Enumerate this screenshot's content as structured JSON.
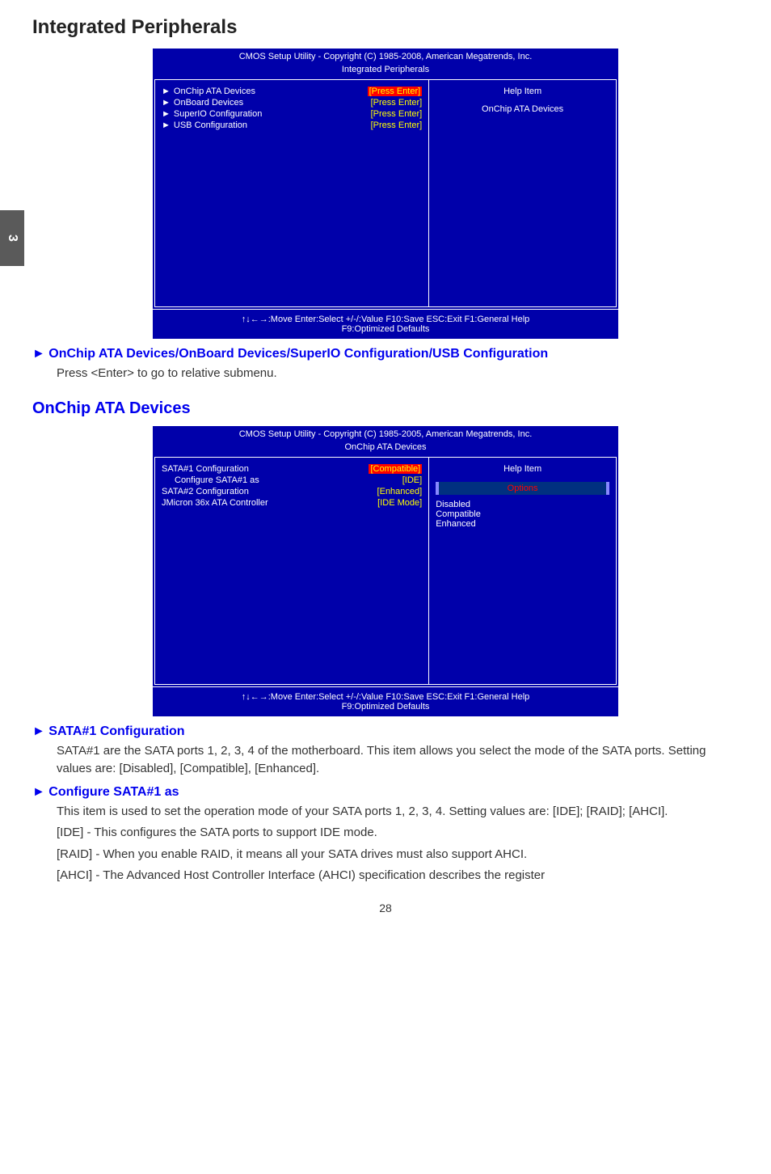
{
  "tab": "3",
  "h1": "Integrated Peripherals",
  "bios1": {
    "title": "CMOS Setup Utility - Copyright (C) 1985-2008, American Megatrends, Inc.",
    "subtitle": "Integrated Peripherals",
    "rows": [
      {
        "label": "OnChip ATA Devices",
        "val": "[Press Enter]",
        "hl": true,
        "arrow": true
      },
      {
        "label": "OnBoard Devices",
        "val": "[Press Enter]",
        "hl": false,
        "arrow": true
      },
      {
        "label": "SuperIO Configuration",
        "val": "[Press Enter]",
        "hl": false,
        "arrow": true
      },
      {
        "label": "USB Configuration",
        "val": "[Press Enter]",
        "hl": false,
        "arrow": true
      }
    ],
    "helpTitle": "Help Item",
    "helpText": "OnChip ATA Devices",
    "foot1": "↑↓←→:Move   Enter:Select   +/-/:Value   F10:Save   ESC:Exit    F1:General Help",
    "foot2": "F9:Optimized Defaults"
  },
  "sec1": {
    "head": "► OnChip ATA Devices/OnBoard Devices/SuperIO Configuration/USB Configuration",
    "body": "Press <Enter> to go to relative submenu."
  },
  "h2": "OnChip ATA Devices",
  "bios2": {
    "title": "CMOS Setup Utility - Copyright (C) 1985-2005, American Megatrends, Inc.",
    "subtitle": "OnChip ATA Devices",
    "rows": [
      {
        "label": "SATA#1 Configuration",
        "val": "[Compatible]",
        "hl": true,
        "indent": false
      },
      {
        "label": "Configure SATA#1 as",
        "val": "[IDE]",
        "hl": false,
        "indent": true
      },
      {
        "label": "SATA#2 Configuration",
        "val": "[Enhanced]",
        "hl": false,
        "indent": false
      },
      {
        "label": "JMicron 36x ATA Controller",
        "val": "[IDE Mode]",
        "hl": false,
        "indent": false
      }
    ],
    "helpTitle": "Help Item",
    "optionsHdr": "Options",
    "opts": [
      "Disabled",
      "Compatible",
      "Enhanced"
    ],
    "foot1": "↑↓←→:Move   Enter:Select   +/-/:Value   F10:Save   ESC:Exit    F1:General Help",
    "foot2": "F9:Optimized Defaults"
  },
  "sec2": {
    "head": "► SATA#1 Configuration",
    "body": "SATA#1 are the SATA ports 1, 2, 3, 4 of the motherboard. This item allows you select the mode of the SATA ports. Setting values are: [Disabled], [Compatible], [Enhanced]."
  },
  "sec3": {
    "head": "► Configure SATA#1 as",
    "b1": "This  item is used to set the operation mode of your SATA ports 1, 2, 3, 4. Setting values are: [IDE]; [RAID]; [AHCI].",
    "b2": "[IDE] - This configures the SATA ports to support IDE mode.",
    "b3": "[RAID] - When you enable RAID, it means all your SATA drives must also support AHCI.",
    "b4": "[AHCI] - The Advanced Host Controller Interface (AHCI) specification describes the register"
  },
  "pageNum": "28"
}
